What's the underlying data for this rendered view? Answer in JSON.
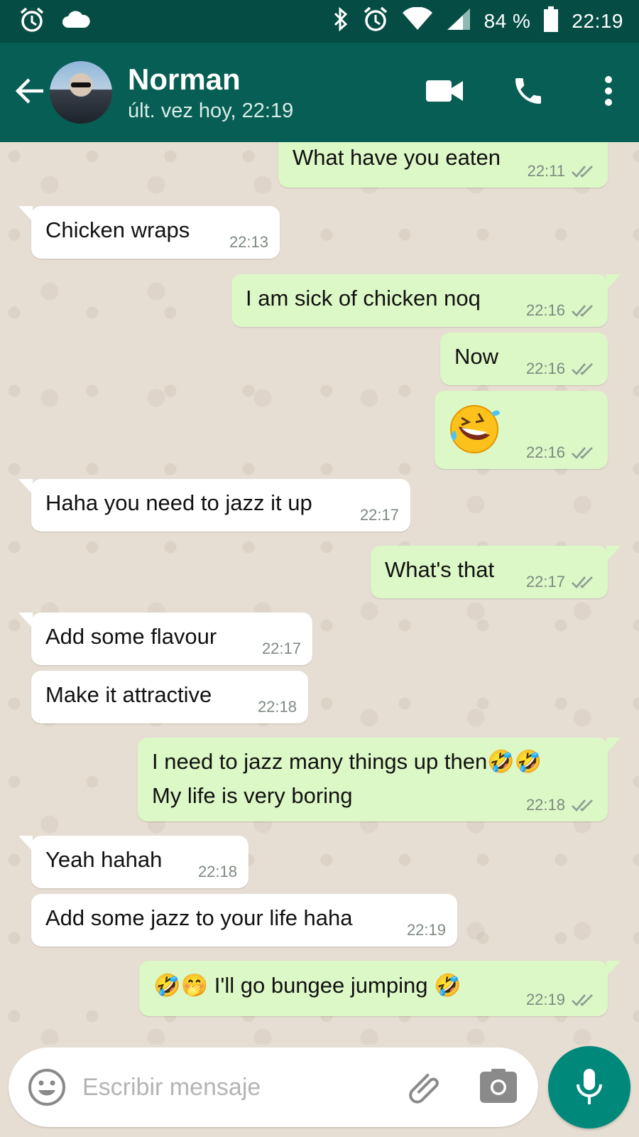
{
  "status_bar": {
    "battery": "84 %",
    "time": "22:19",
    "icons": [
      "alarm-icon",
      "cloud-icon",
      "bluetooth-icon",
      "alarm-icon",
      "wifi-icon",
      "signal-icon",
      "battery-icon"
    ]
  },
  "header": {
    "contact_name": "Norman",
    "last_seen": "últ. vez hoy, 22:19",
    "icons": [
      "back-arrow-icon",
      "video-call-icon",
      "phone-icon",
      "more-menu-icon"
    ]
  },
  "messages": [
    {
      "direction": "out",
      "text": "What have you eaten",
      "time": "22:11",
      "status": "read"
    },
    {
      "direction": "in",
      "text": "Chicken wraps",
      "time": "22:13"
    },
    {
      "direction": "out",
      "text": "I am sick of chicken noq",
      "time": "22:16",
      "status": "read"
    },
    {
      "direction": "out",
      "text": "Now",
      "time": "22:16",
      "status": "read"
    },
    {
      "direction": "out",
      "text": "🤣",
      "time": "22:16",
      "status": "read"
    },
    {
      "direction": "in",
      "text": "Haha you need to jazz it up",
      "time": "22:17"
    },
    {
      "direction": "out",
      "text": "What's that",
      "time": "22:17",
      "status": "read"
    },
    {
      "direction": "in",
      "text": "Add some flavour",
      "time": "22:17"
    },
    {
      "direction": "in",
      "text": "Make it attractive",
      "time": "22:18"
    },
    {
      "direction": "out",
      "text": "I need to jazz many things up then🤣🤣\nMy life is very boring",
      "time": "22:18",
      "status": "read"
    },
    {
      "direction": "in",
      "text": "Yeah hahah",
      "time": "22:18"
    },
    {
      "direction": "in",
      "text": "Add some jazz to your life haha",
      "time": "22:19"
    },
    {
      "direction": "out",
      "text": "🤣🤭 I'll go bungee jumping 🤣",
      "time": "22:19",
      "status": "read"
    }
  ],
  "input": {
    "placeholder": "Escribir mensaje",
    "value": "",
    "icons": [
      "emoji-icon",
      "attach-icon",
      "camera-icon",
      "mic-icon"
    ]
  },
  "colors": {
    "header": "#075e54",
    "status_bar": "#054d44",
    "outgoing_bubble": "#dcf8c6",
    "incoming_bubble": "#ffffff",
    "chat_background": "#e7ded3",
    "mic_button": "#00897b",
    "read_ticks": "#8c9a92"
  }
}
